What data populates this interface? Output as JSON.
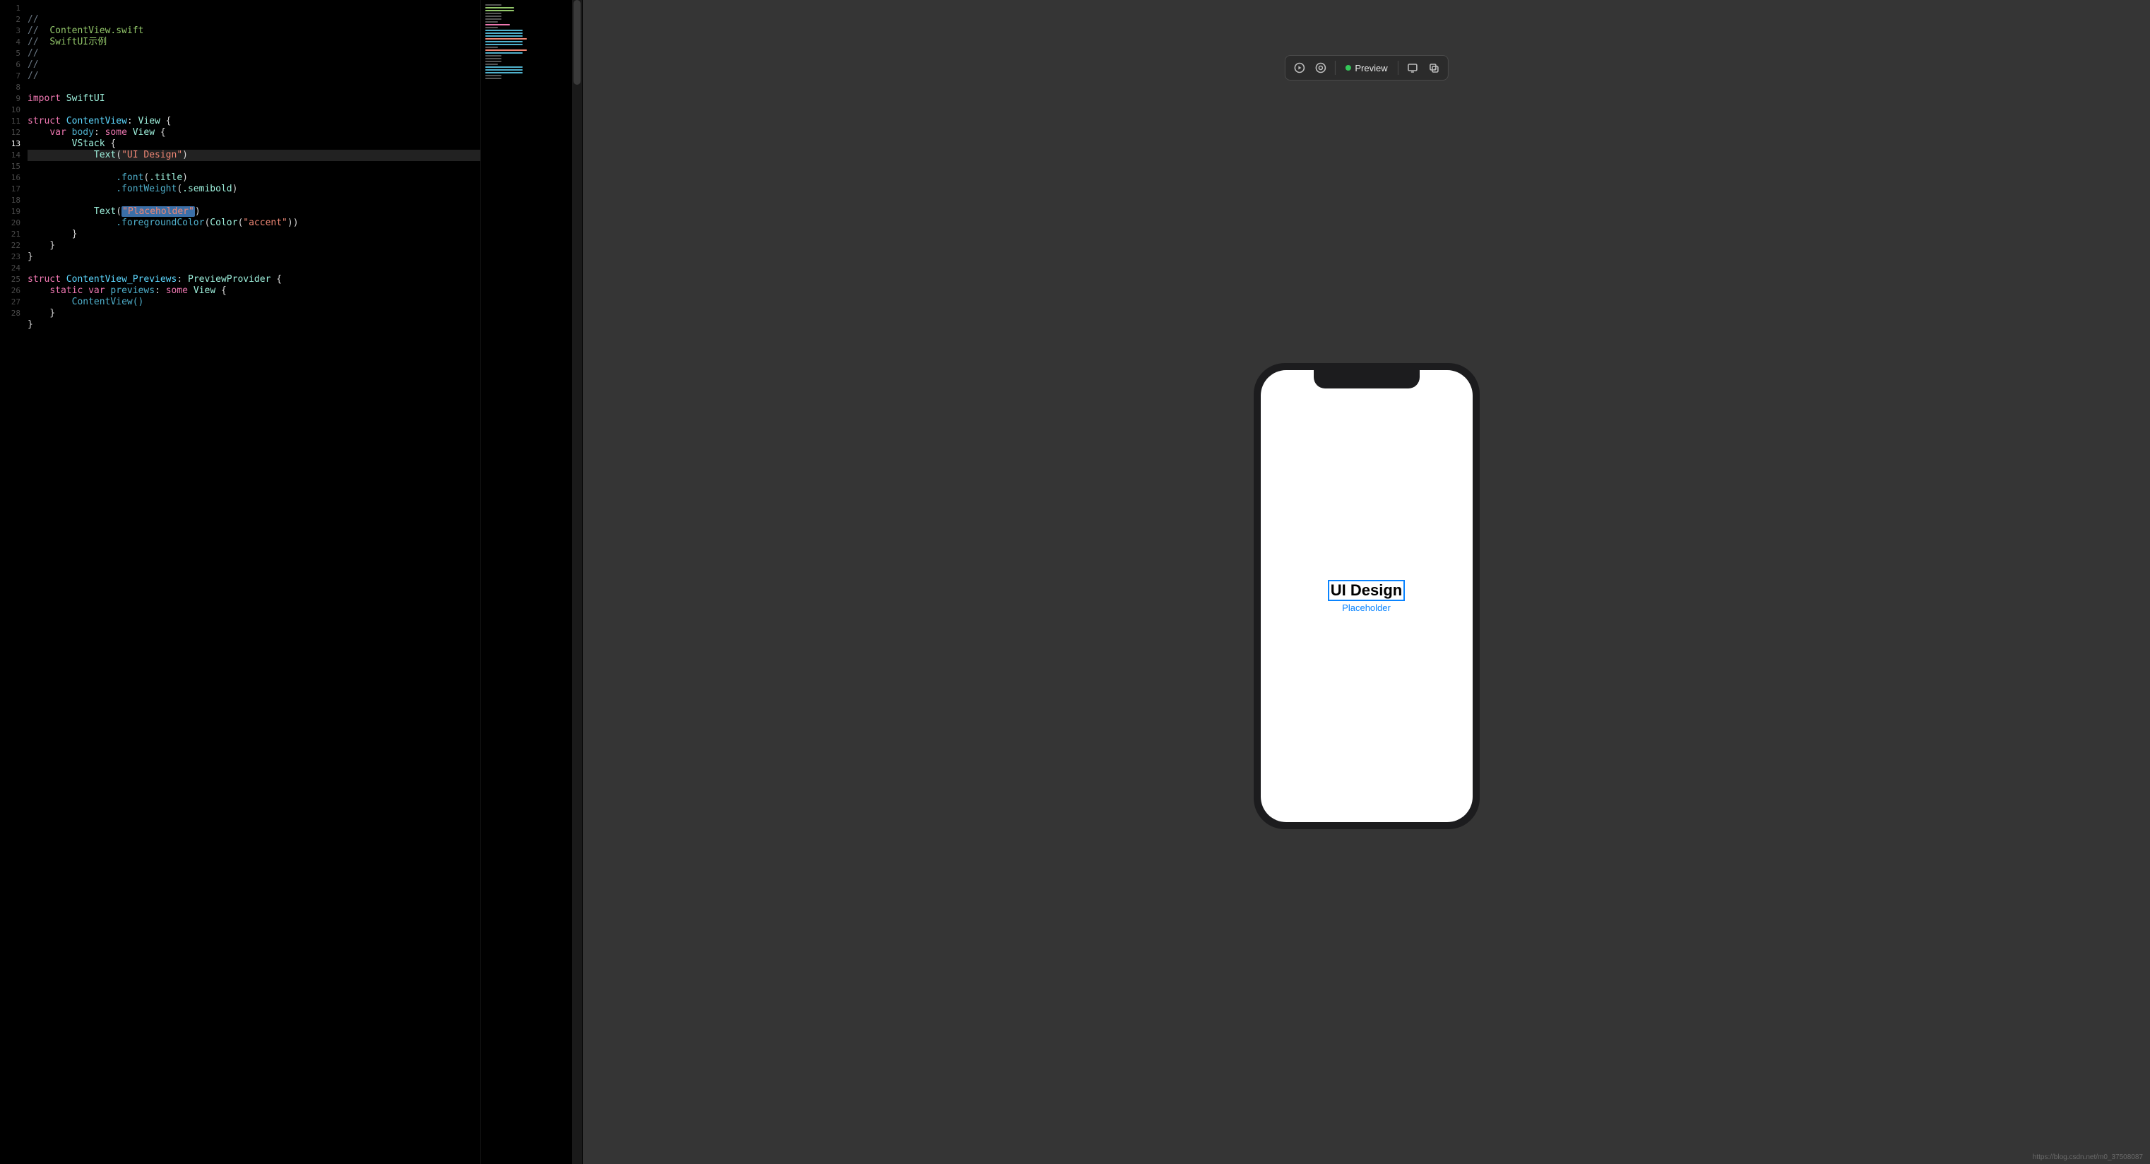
{
  "editor": {
    "line_numbers": [
      "1",
      "2",
      "3",
      "4",
      "5",
      "6",
      "7",
      "8",
      "9",
      "10",
      "11",
      "12",
      "13",
      "14",
      "15",
      "16",
      "17",
      "18",
      "19",
      "20",
      "21",
      "22",
      "23",
      "24",
      "25",
      "26",
      "27",
      "28"
    ],
    "current_line": "13",
    "tokens": {
      "comment_slash": "//",
      "comment_filename": "ContentView.swift",
      "comment_project": "SwiftUI示例",
      "kw_import": "import",
      "mod_swiftui": "SwiftUI",
      "kw_struct": "struct",
      "id_contentview": "ContentView",
      "t_view": "View",
      "kw_var": "var",
      "id_body": "body",
      "kw_some": "some",
      "t_vstack": "VStack",
      "t_text": "Text",
      "str_ui_design": "\"UI Design\"",
      "m_font": ".font",
      "e_title": ".title",
      "m_fontweight": ".fontWeight",
      "e_semibold": ".semibold",
      "str_placeholder": "\"Placeholder\"",
      "m_fgcolor": ".foregroundColor",
      "t_color": "Color",
      "str_accent": "\"accent\"",
      "id_previews_struct": "ContentView_Previews",
      "t_previewprovider": "PreviewProvider",
      "kw_static": "static",
      "id_previews": "previews",
      "call_contentview": "ContentView()"
    }
  },
  "preview_toolbar": {
    "live_label": "Preview"
  },
  "preview_content": {
    "title": "UI Design",
    "subtitle": "Placeholder"
  },
  "watermark": "https://blog.csdn.net/m0_37508087"
}
